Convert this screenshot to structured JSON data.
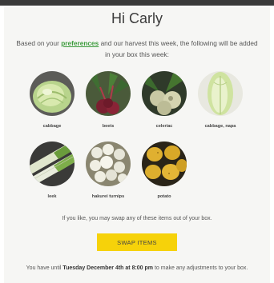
{
  "greeting": "Hi Carly",
  "intro": {
    "before": "Based on your ",
    "link": "preferences",
    "after": " and our harvest this week, the following will be added in your box this week:"
  },
  "items": [
    {
      "label": "cabbage",
      "icon": "cabbage"
    },
    {
      "label": "beets",
      "icon": "beets"
    },
    {
      "label": "celeriac",
      "icon": "celeriac"
    },
    {
      "label": "cabbage, napa",
      "icon": "napa-cabbage"
    },
    {
      "label": "leek",
      "icon": "leek"
    },
    {
      "label": "hakurei turnips",
      "icon": "turnips"
    },
    {
      "label": "potato",
      "icon": "potato"
    }
  ],
  "swap_note": "If you like, you may swap any of these items out of your box.",
  "swap_button": "SWAP ITEMS",
  "deadline": {
    "before": "You have until ",
    "date": "Tuesday December 4th at 8:00 pm",
    "after": " to make any adjustments to your box."
  },
  "colors": {
    "accent": "#f6d20a",
    "link": "#3a9a3a",
    "background": "#f6f6f4"
  }
}
